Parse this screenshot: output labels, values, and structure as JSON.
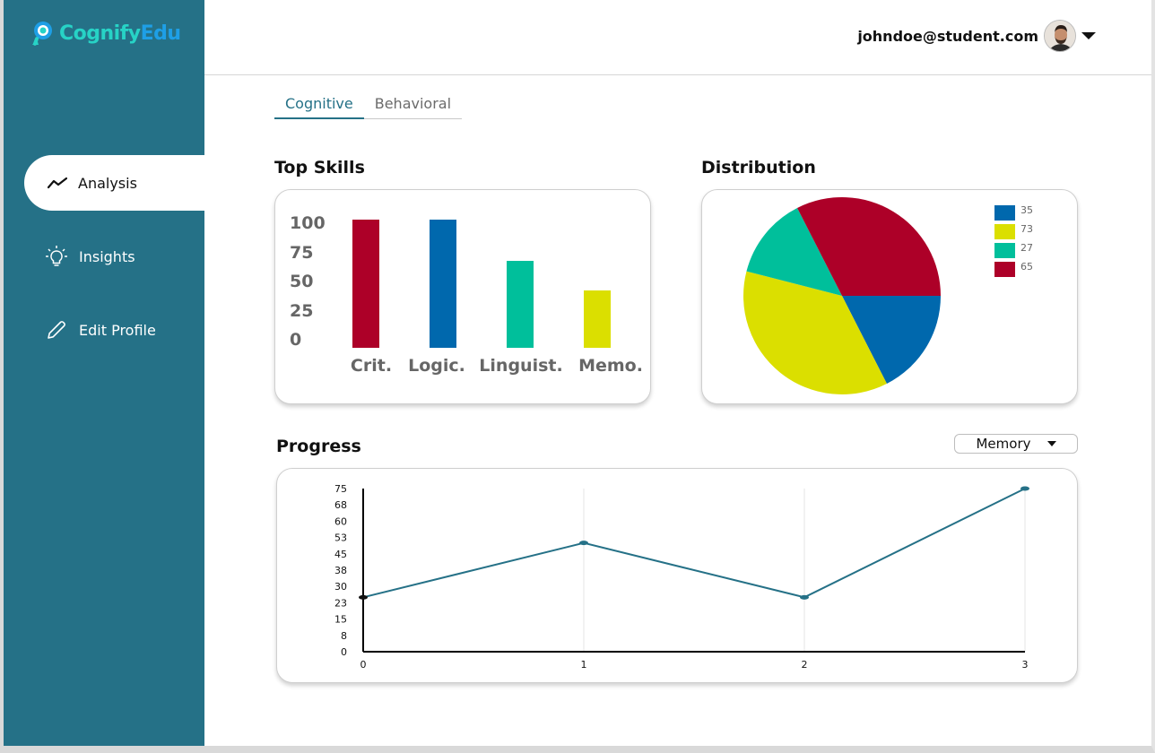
{
  "brand": {
    "name_part1": "Cognify",
    "name_part2": "Edu",
    "color1": "#27d3c6",
    "color2": "#1e9fe6"
  },
  "sidebar": {
    "background": "#257187",
    "items": [
      {
        "label": "Analysis",
        "icon": "trend-line-icon",
        "active": true
      },
      {
        "label": "Insights",
        "icon": "lightbulb-icon",
        "active": false
      },
      {
        "label": "Edit Profile",
        "icon": "pencil-icon",
        "active": false
      }
    ]
  },
  "header": {
    "user_email": "johndoe@student.com",
    "avatar": "user-avatar",
    "menu_icon": "caret-down-icon"
  },
  "tabs": [
    {
      "label": "Cognitive",
      "active": true
    },
    {
      "label": "Behavioral",
      "active": false
    }
  ],
  "sections": {
    "top_skills": "Top Skills",
    "distribution": "Distribution",
    "progress": "Progress"
  },
  "progress_filter": {
    "selected": "Memory"
  },
  "chart_data": [
    {
      "type": "bar",
      "categories": [
        "Crit.",
        "Logic.",
        "Linguist.",
        "Memo."
      ],
      "values": [
        100,
        100,
        68,
        45
      ],
      "colors": [
        "#ad0028",
        "#0068ad",
        "#00bf9b",
        "#dbdf00"
      ],
      "yticks": [
        "100",
        "75",
        "50",
        "25",
        "0"
      ],
      "ylim": [
        0,
        100
      ],
      "title": "",
      "xlabel": "",
      "ylabel": ""
    },
    {
      "type": "pie",
      "labels": [
        "35",
        "73",
        "27",
        "65"
      ],
      "values": [
        35,
        73,
        27,
        65
      ],
      "colors": [
        "#0068ad",
        "#dbdf00",
        "#00bf9b",
        "#ad0028"
      ],
      "legend_placement": "top-right"
    },
    {
      "type": "line",
      "x": [
        0,
        1,
        2,
        3
      ],
      "values": [
        25,
        50,
        25,
        75
      ],
      "xticks": [
        "0",
        "1",
        "2",
        "3"
      ],
      "yticks": [
        "75",
        "68",
        "60",
        "53",
        "45",
        "38",
        "30",
        "23",
        "15",
        "8",
        "0"
      ],
      "ylim": [
        0,
        75
      ],
      "line_color": "#257187",
      "grid": "vertical"
    }
  ]
}
